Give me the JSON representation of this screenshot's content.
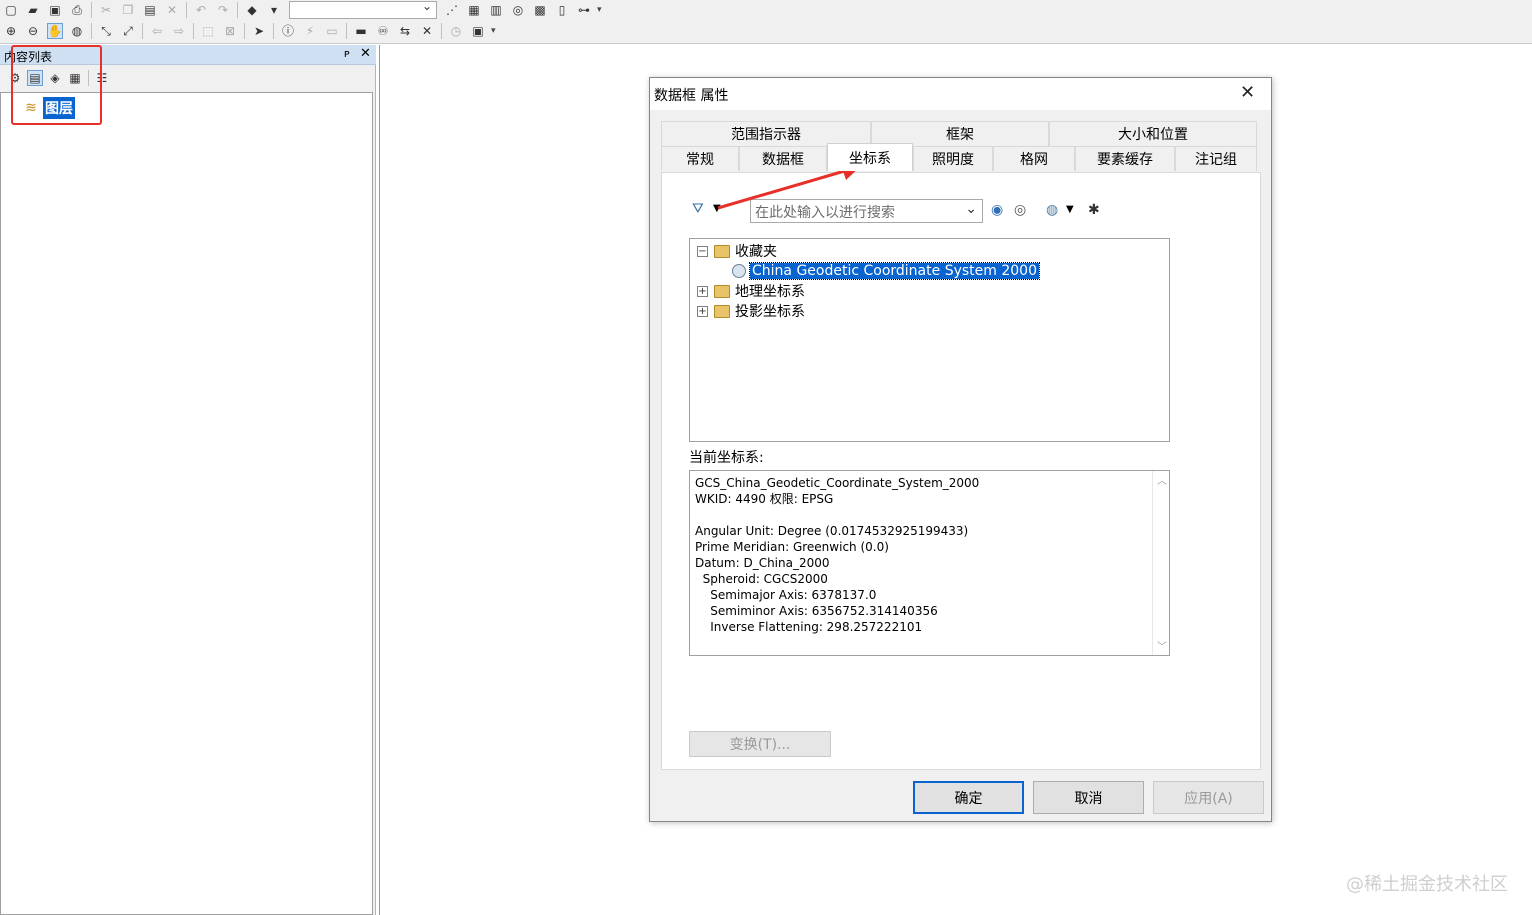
{
  "toc": {
    "title": "内容列表",
    "pin": "ᴘ",
    "close": "✕",
    "root_layer": "图层"
  },
  "dialog": {
    "title": "数据框 属性",
    "close": "✕",
    "tabs_row1": [
      "范围指示器",
      "框架",
      "大小和位置"
    ],
    "tabs_row2": [
      "常规",
      "数据框",
      "坐标系",
      "照明度",
      "格网",
      "要素缓存",
      "注记组"
    ],
    "active_tab": "坐标系",
    "search_placeholder": "在此处输入以进行搜索",
    "tree": {
      "favorites": "收藏夹",
      "favorite_item": "China Geodetic Coordinate System 2000",
      "geographic": "地理坐标系",
      "projected": "投影坐标系"
    },
    "current_label": "当前坐标系:",
    "current_lines": [
      "GCS_China_Geodetic_Coordinate_System_2000",
      "WKID: 4490 权限: EPSG",
      "",
      "Angular Unit: Degree (0.0174532925199433)",
      "Prime Meridian: Greenwich (0.0)",
      "Datum: D_China_2000",
      "  Spheroid: CGCS2000",
      "    Semimajor Axis: 6378137.0",
      "    Semiminor Axis: 6356752.314140356",
      "    Inverse Flattening: 298.257222101"
    ],
    "transform_button": "变换(T)...",
    "ok": "确定",
    "cancel": "取消",
    "apply": "应用(A)"
  },
  "watermark": "@稀土掘金技术社区",
  "colors": {
    "selection": "#0a64d0",
    "annotation_red": "#e8302a",
    "toc_header": "#cfe0f3"
  }
}
